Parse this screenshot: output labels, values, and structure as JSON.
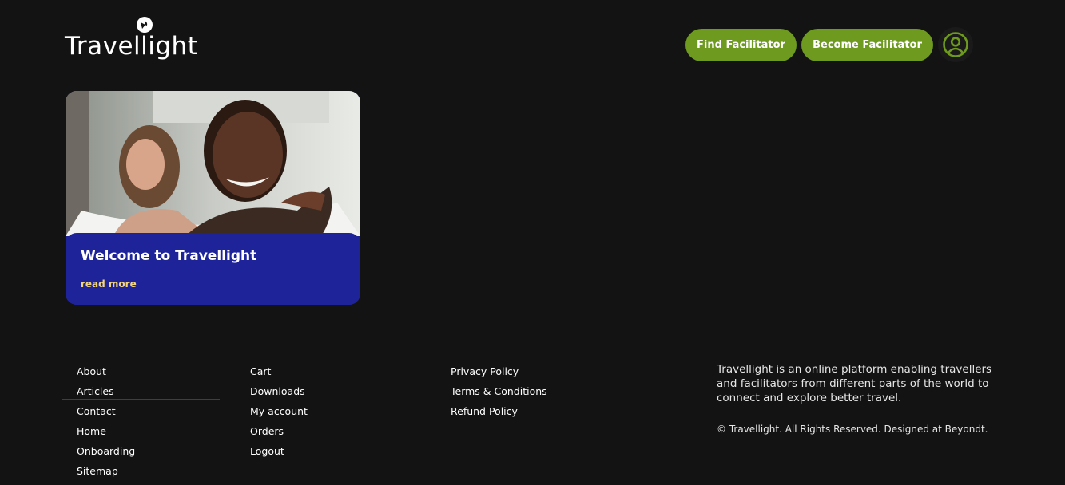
{
  "header": {
    "logo_text": "Travellight",
    "find_facilitator": "Find Facilitator",
    "become_facilitator": "Become Facilitator",
    "account_icon": "user-circle-icon"
  },
  "card": {
    "title": "Welcome to Travellight",
    "link": "read more"
  },
  "footer": {
    "col1": [
      "About",
      "Articles",
      "Contact",
      "Home",
      "Onboarding",
      "Sitemap"
    ],
    "col2": [
      "Cart",
      "Downloads",
      "My account",
      "Orders",
      "Logout"
    ],
    "col3": [
      "Privacy Policy",
      "Terms & Conditions",
      "Refund Policy"
    ],
    "about": "Travellight is an online platform enabling travellers and facilitators from different parts of the world to connect and explore better travel.",
    "copyright": "© Travellight. All Rights Reserved. Designed at Beyondt."
  },
  "colors": {
    "background": "#131313",
    "accent_green": "#6d9a1f",
    "card_blue": "#1f2399",
    "link_gold": "#f2d57a"
  }
}
